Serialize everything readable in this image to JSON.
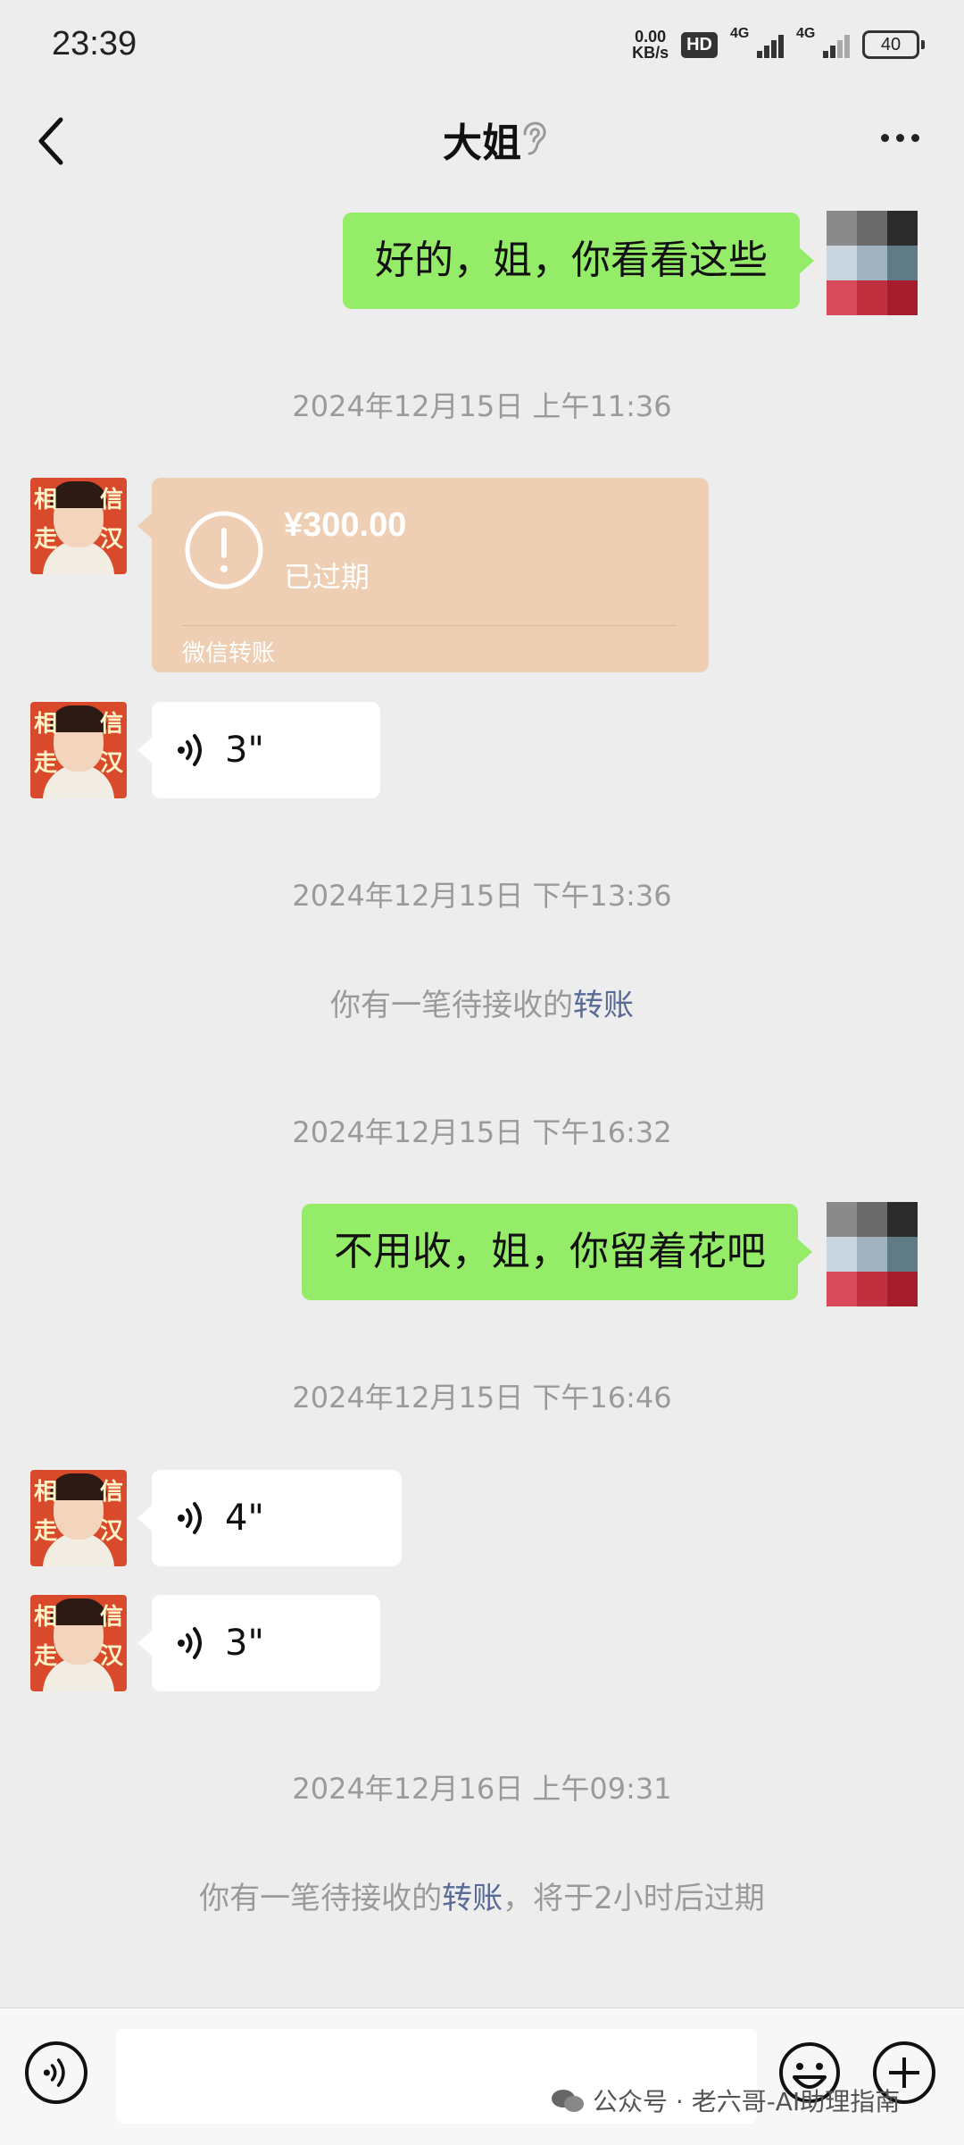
{
  "status_bar": {
    "time": "23:39",
    "net_speed_value": "0.00",
    "net_speed_unit": "KB/s",
    "hd_label": "HD",
    "signal1_label": "4G",
    "signal2_label": "4G",
    "battery": "40"
  },
  "header": {
    "title": "大姐"
  },
  "messages": {
    "m1_text": "好的，姐，你看看这些",
    "ts1": "2024年12月15日 上午11:36",
    "transfer_amount": "¥300.00",
    "transfer_status": "已过期",
    "transfer_footer": "微信转账",
    "voice1_duration": "3\"",
    "ts2": "2024年12月15日 下午13:36",
    "sys1_prefix": "你有一笔待接收的",
    "sys1_link": "转账",
    "ts3": "2024年12月15日 下午16:32",
    "m2_text": "不用收，姐，你留着花吧",
    "ts4": "2024年12月15日 下午16:46",
    "voice2_duration": "4\"",
    "voice3_duration": "3\"",
    "ts5": "2024年12月16日 上午09:31",
    "sys2_prefix": "你有一笔待接收的",
    "sys2_link": "转账",
    "sys2_suffix": "，将于2小时后过期"
  },
  "avatar_her": {
    "char1": "相",
    "char2": "信",
    "char3": "走",
    "char4": "汉"
  },
  "input_bar": {
    "placeholder": ""
  },
  "watermark": {
    "text": "公众号 · 老六哥-AI助理指南"
  },
  "colors": {
    "out_bubble": "#95ec69",
    "transfer_card": "#eecfb4",
    "link": "#576b95",
    "background": "#ededed"
  }
}
